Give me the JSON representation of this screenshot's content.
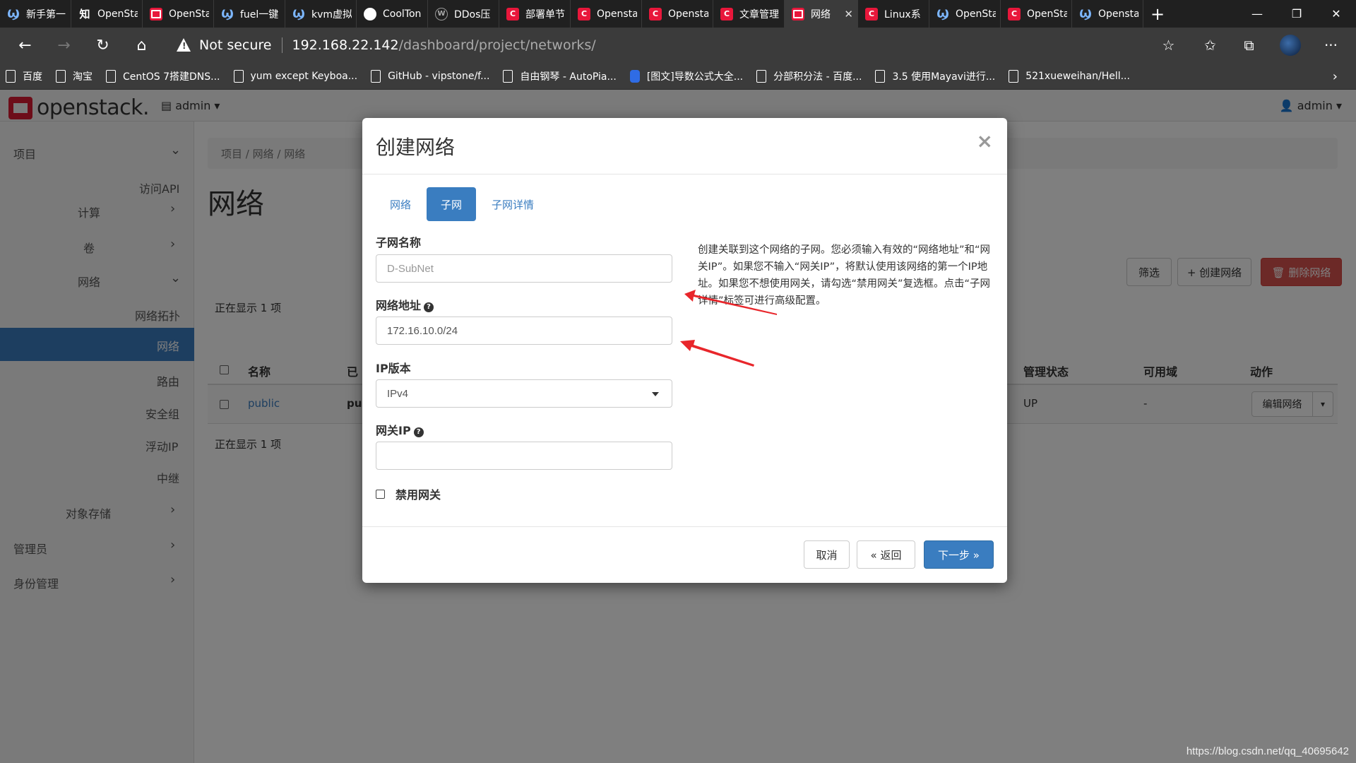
{
  "browser": {
    "tabs": [
      {
        "icon": "ck",
        "label": "新手第一"
      },
      {
        "icon": "zhi",
        "label": "OpenSta"
      },
      {
        "icon": "os",
        "label": "OpenSta"
      },
      {
        "icon": "ck",
        "label": "fuel一键"
      },
      {
        "icon": "ck",
        "label": "kvm虚拟"
      },
      {
        "icon": "gh",
        "label": "CoolTon"
      },
      {
        "icon": "w",
        "label": "DDos压"
      },
      {
        "icon": "c",
        "label": "部署单节"
      },
      {
        "icon": "c",
        "label": "Opensta"
      },
      {
        "icon": "c",
        "label": "Opensta"
      },
      {
        "icon": "c",
        "label": "文章管理"
      },
      {
        "icon": "os",
        "label": "网络",
        "active": true
      },
      {
        "icon": "c",
        "label": "Linux系"
      },
      {
        "icon": "ck",
        "label": "OpenSta"
      },
      {
        "icon": "c",
        "label": "OpenSta"
      },
      {
        "icon": "ck",
        "label": "Opensta"
      }
    ],
    "new_tab": "+",
    "window_controls": {
      "minimize": "—",
      "restore": "❐",
      "close": "✕"
    },
    "nav": {
      "back": "←",
      "forward": "→",
      "reload": "↻",
      "home": "⌂"
    },
    "security_label": "Not secure",
    "url_host": "192.168.22.142",
    "url_path": "/dashboard/project/networks/",
    "toolbar_icons": {
      "favorite": "☆",
      "favorites": "✩",
      "collections": "⧉",
      "more": "···"
    },
    "bookmarks": [
      {
        "label": "百度"
      },
      {
        "label": "淘宝"
      },
      {
        "label": "CentOS 7搭建DNS..."
      },
      {
        "label": "yum except Keyboa..."
      },
      {
        "label": "GitHub - vipstone/f..."
      },
      {
        "label": "自由钢琴 - AutoPia..."
      },
      {
        "label": "[图文]导数公式大全...",
        "icon": "baidu"
      },
      {
        "label": "分部积分法 - 百度..."
      },
      {
        "label": "3.5 使用Mayavi进行..."
      },
      {
        "label": "521xueweihan/Hell..."
      }
    ],
    "bookmarks_more": "›"
  },
  "openstack": {
    "logo_text": "openstack.",
    "project_selector": "admin",
    "user_menu": "admin",
    "sidebar": [
      {
        "label": "项目",
        "chevron": "⌄"
      },
      {
        "label": "访问API"
      },
      {
        "label": "计算",
        "chevron": "›"
      },
      {
        "label": "卷",
        "chevron": "›"
      },
      {
        "label": "网络",
        "chevron": "⌄"
      },
      {
        "label": "网络拓扑"
      },
      {
        "label": "网络",
        "active": true
      },
      {
        "label": "路由"
      },
      {
        "label": "安全组"
      },
      {
        "label": "浮动IP"
      },
      {
        "label": "中继"
      },
      {
        "label": "对象存储",
        "chevron": "›"
      },
      {
        "label": "管理员",
        "chevron": "›"
      },
      {
        "label": "身份管理",
        "chevron": "›"
      }
    ],
    "breadcrumb": [
      "项目",
      "网络",
      "网络"
    ],
    "page_title": "网络",
    "filter_button": "筛选",
    "create_button": "+ 创建网络",
    "delete_button": "🗑 删除网络",
    "showing_text": "正在显示 1 项",
    "table_headers": {
      "name": "名称",
      "shared": "已",
      "admin_state": "管理状态",
      "availability": "可用域",
      "actions": "动作"
    },
    "table_row": {
      "name": "public",
      "shared": "pu",
      "admin_state": "UP",
      "availability": "-",
      "action": "编辑网络",
      "action_caret": "▾"
    }
  },
  "modal": {
    "title": "创建网络",
    "close": "×",
    "tabs": [
      {
        "label": "网络"
      },
      {
        "label": "子网",
        "active": true
      },
      {
        "label": "子网详情"
      }
    ],
    "subnet_name": {
      "label": "子网名称",
      "value": "D-SubNet"
    },
    "network_address": {
      "label": "网络地址",
      "value": "172.16.10.0/24"
    },
    "ip_version": {
      "label": "IP版本",
      "value": "IPv4"
    },
    "gateway_ip": {
      "label": "网关IP",
      "value": ""
    },
    "disable_gateway": {
      "label": "禁用网关",
      "checked": false
    },
    "help_text": "创建关联到这个网络的子网。您必须输入有效的“网络地址”和“网关IP”。如果您不输入“网关IP”，将默认使用该网络的第一个IP地址。如果您不想使用网关，请勾选“禁用网关”复选框。点击“子网详情”标签可进行高级配置。",
    "help_icon": "?",
    "buttons": {
      "cancel": "取消",
      "back": "« 返回",
      "next": "下一步 »"
    }
  },
  "annotation_color": "#e8262b",
  "watermark": "https://blog.csdn.net/qq_40695642"
}
